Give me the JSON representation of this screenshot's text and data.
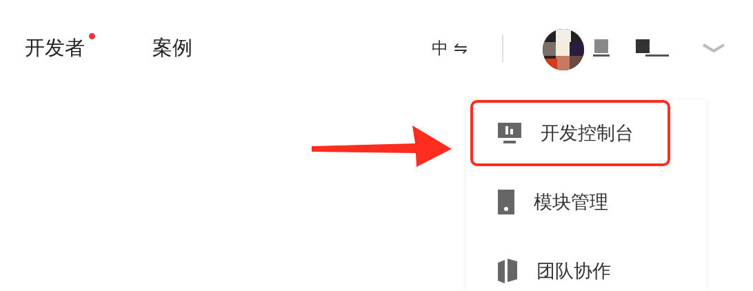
{
  "nav": [
    {
      "label": "开发者",
      "badge_dot": true
    },
    {
      "label": "案例",
      "badge_dot": false
    }
  ],
  "language": {
    "label": "中",
    "switch_glyph": "⇋"
  },
  "user_menu": {
    "expanded": true,
    "items": [
      {
        "label": "开发控制台",
        "highlighted": true
      },
      {
        "label": "模块管理",
        "highlighted": false
      },
      {
        "label": "团队协作",
        "highlighted": false
      }
    ]
  }
}
